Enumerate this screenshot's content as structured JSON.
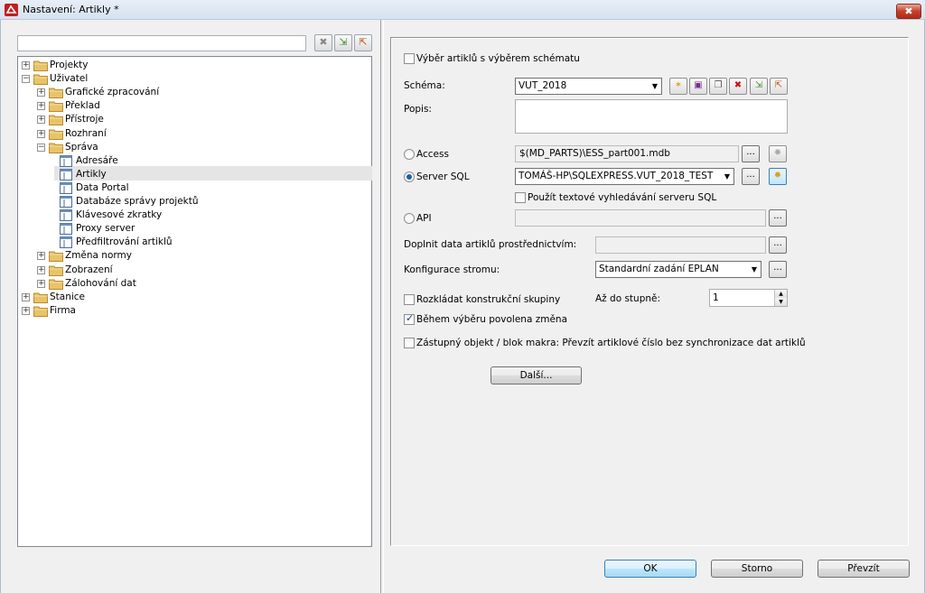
{
  "window": {
    "title": "Nastavení: Artikly *",
    "close_glyph": "✖"
  },
  "left": {
    "search_value": "",
    "buttons": {
      "clear": "✖",
      "expand": "⇲",
      "collapse": "⇱"
    },
    "tree": [
      {
        "label": "Projekty"
      },
      {
        "label": "Uživatel"
      },
      {
        "label": "Grafické zpracování"
      },
      {
        "label": "Překlad"
      },
      {
        "label": "Přístroje"
      },
      {
        "label": "Rozhraní"
      },
      {
        "label": "Správa"
      },
      {
        "label": "Adresáře"
      },
      {
        "label": "Artikly"
      },
      {
        "label": "Data Portal"
      },
      {
        "label": "Databáze správy projektů"
      },
      {
        "label": "Klávesové zkratky"
      },
      {
        "label": "Proxy server"
      },
      {
        "label": "Předfiltrování artiklů"
      },
      {
        "label": "Změna normy"
      },
      {
        "label": "Zobrazení"
      },
      {
        "label": "Zálohování dat"
      },
      {
        "label": "Stanice"
      },
      {
        "label": "Firma"
      }
    ]
  },
  "right": {
    "schema_selection_label": "Výběr artiklů s výběrem schématu",
    "schema_label": "Schéma:",
    "schema_value": "VUT_2018",
    "description_label": "Popis:",
    "description_value": "",
    "access_label": "Access",
    "access_value": "$(MD_PARTS)\\ESS_part001.mdb",
    "sql_label": "Server SQL",
    "sql_value": "TOMÁŠ-HP\\SQLEXPRESS.VUT_2018_TEST",
    "sql_fulltext_label": "Použít textové vyhledávání serveru SQL",
    "api_label": "API",
    "api_value": "",
    "supplement_label": "Doplnit data artiklů prostřednictvím:",
    "supplement_value": "",
    "tree_config_label": "Konfigurace stromu:",
    "tree_config_value": "Standardní zadání EPLAN",
    "explode_label": "Rozkládat konstrukční skupiny",
    "up_to_level_label": "Až do stupně:",
    "up_to_level_value": "1",
    "allow_change_label": "Během výběru povolena změna",
    "placeholder_label": "Zástupný objekt / blok makra: Převzít artiklové číslo bez synchronizace dat artiklů",
    "more_button": "Další...",
    "dots": "...",
    "combo_arrow": "▼",
    "spin_up": "▲",
    "spin_down": "▼"
  },
  "footer": {
    "ok": "OK",
    "cancel": "Storno",
    "apply": "Převzít"
  },
  "colors": {
    "accent": "#3c7fb1",
    "delete": "#cc1010",
    "folder": "#e9c36a"
  },
  "icons": [
    "app-icon",
    "close-icon",
    "clear-icon",
    "expand-icon",
    "collapse-icon",
    "folder-icon",
    "settings-page-icon",
    "new-icon",
    "save-icon",
    "copy-icon",
    "delete-icon",
    "import-icon",
    "export-icon",
    "sun-icon"
  ]
}
